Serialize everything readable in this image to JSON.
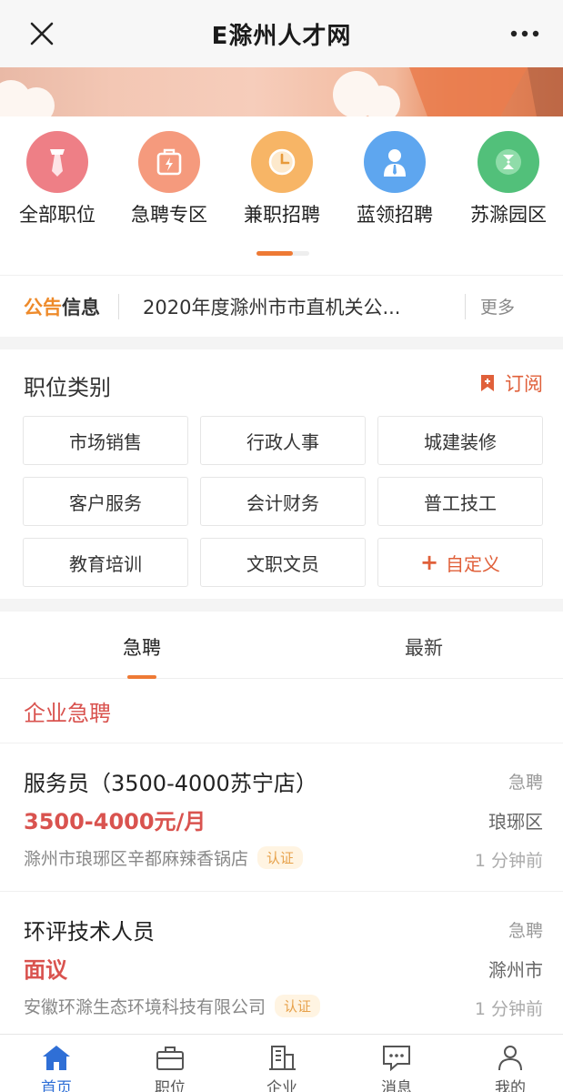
{
  "topbar": {
    "title": "E滁州人才网"
  },
  "quick_links": [
    {
      "label": "全部职位",
      "icon": "tie-icon",
      "color": "#ee7f86"
    },
    {
      "label": "急聘专区",
      "icon": "urgent-bag-icon",
      "color": "#f59a7d"
    },
    {
      "label": "兼职招聘",
      "icon": "clock-icon",
      "color": "#f7b566"
    },
    {
      "label": "蓝领招聘",
      "icon": "worker-icon",
      "color": "#5ea6ef"
    },
    {
      "label": "苏滁园区",
      "icon": "park-logo-icon",
      "color": "#52c07a"
    }
  ],
  "notice": {
    "label_a": "公告",
    "label_b": "信息",
    "text": "2020年度滁州市市直机关公...",
    "more": "更多"
  },
  "categories": {
    "title": "职位类别",
    "subscribe": "订阅",
    "items": [
      "市场销售",
      "行政人事",
      "城建装修",
      "客户服务",
      "会计财务",
      "普工技工",
      "教育培训",
      "文职文员"
    ],
    "custom": "自定义"
  },
  "tabs": [
    "急聘",
    "最新"
  ],
  "section_title": "企业急聘",
  "jobs": [
    {
      "title": "服务员（3500-4000苏宁店）",
      "tag": "急聘",
      "salary": "3500-4000元/月",
      "location": "琅琊区",
      "company": "滁州市琅琊区辛都麻辣香锅店",
      "badge": "认证",
      "time": "1 分钟前"
    },
    {
      "title": "环评技术人员",
      "tag": "急聘",
      "salary": "面议",
      "location": "滁州市",
      "company": "安徽环滁生态环境科技有限公司",
      "badge": "认证",
      "time": "1 分钟前"
    }
  ],
  "tabbar": [
    {
      "label": "首页",
      "icon": "home-icon"
    },
    {
      "label": "职位",
      "icon": "briefcase-icon"
    },
    {
      "label": "企业",
      "icon": "building-icon"
    },
    {
      "label": "消息",
      "icon": "chat-icon"
    },
    {
      "label": "我的",
      "icon": "user-icon"
    }
  ],
  "colors": {
    "accent": "#ee7a35",
    "red": "#d9534f",
    "blue": "#2f6fd6"
  }
}
